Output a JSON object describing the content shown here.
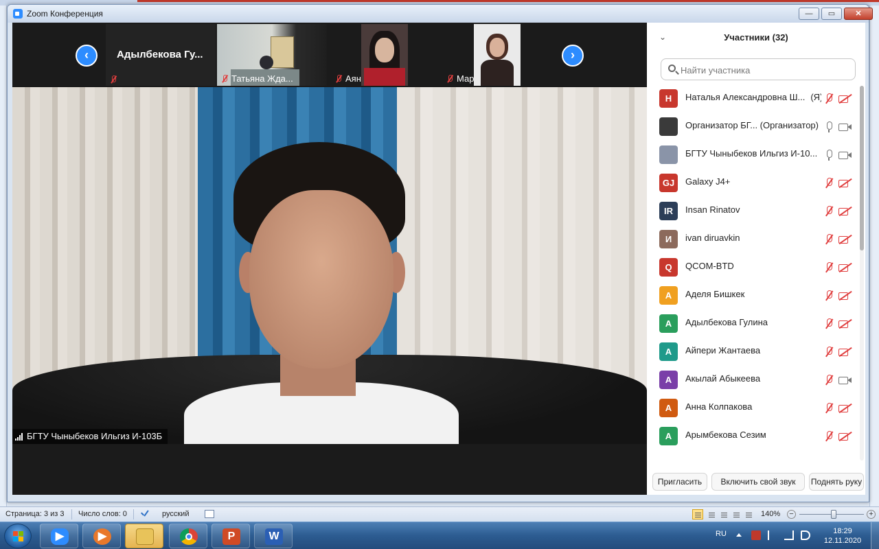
{
  "window": {
    "title": "Zoom Конференция",
    "minimize_label": "—",
    "maximize_label": "▭",
    "close_label": "✕"
  },
  "filmstrip": {
    "prev_label": "‹",
    "next_label": "›",
    "tiles": [
      {
        "name": "Адылбекова Гу...",
        "muted": true,
        "video": false
      },
      {
        "name": "Татьяна Жда...",
        "muted": true,
        "video": true
      },
      {
        "name": "Аяна",
        "muted": true,
        "video": true
      },
      {
        "name": "Марина Ому...",
        "muted": true,
        "video": true
      }
    ]
  },
  "main_video": {
    "speaker_name": "БГТУ Чыныбеков Ильгиз  И-103Б",
    "signal_icon": "signal-bars-icon"
  },
  "participants_panel": {
    "title": "Участники (32)",
    "collapse_icon": "chevron-down-icon",
    "search_placeholder": "Найти участника",
    "participants": [
      {
        "initials": "Н",
        "color": "#c8372d",
        "name": "Наталья Александровна Ш...",
        "tag": "(Я)",
        "mic": "off",
        "cam": "off"
      },
      {
        "initials": "",
        "color": "#3a3a3a",
        "name": "Организатор БГ... (Организатор)",
        "tag": "",
        "mic": "on",
        "cam": "on"
      },
      {
        "initials": "",
        "color": "#8a94a8",
        "name": "БГТУ Чыныбеков Ильгиз  И-10...",
        "tag": "",
        "mic": "on",
        "cam": "on"
      },
      {
        "initials": "GJ",
        "color": "#c8372d",
        "name": "Galaxy J4+",
        "tag": "",
        "mic": "off",
        "cam": "off"
      },
      {
        "initials": "IR",
        "color": "#2c3e58",
        "name": "Insan Rinatov",
        "tag": "",
        "mic": "off",
        "cam": "off"
      },
      {
        "initials": "И",
        "color": "#8c6a5c",
        "name": "ivan diruavkin",
        "tag": "",
        "mic": "off",
        "cam": "off"
      },
      {
        "initials": "Q",
        "color": "#c8372d",
        "name": "QCOM-BTD",
        "tag": "",
        "mic": "off",
        "cam": "off"
      },
      {
        "initials": "А",
        "color": "#f0a020",
        "name": "Аделя Бишкек",
        "tag": "",
        "mic": "off",
        "cam": "off"
      },
      {
        "initials": "А",
        "color": "#2a9e5c",
        "name": "Адылбекова Гулина",
        "tag": "",
        "mic": "off",
        "cam": "off"
      },
      {
        "initials": "А",
        "color": "#1f9a8a",
        "name": "Айпери Жантаева",
        "tag": "",
        "mic": "off",
        "cam": "off"
      },
      {
        "initials": "А",
        "color": "#7a3fa8",
        "name": "Акылай Абыкеева",
        "tag": "",
        "mic": "off",
        "cam": "on"
      },
      {
        "initials": "А",
        "color": "#d05a10",
        "name": "Анна Колпакова",
        "tag": "",
        "mic": "off",
        "cam": "off"
      },
      {
        "initials": "А",
        "color": "#2a9e5c",
        "name": "Арымбекова Сезим",
        "tag": "",
        "mic": "off",
        "cam": "off"
      }
    ],
    "buttons": {
      "invite": "Пригласить",
      "unmute": "Включить свой звук",
      "raise_hand": "Поднять руку"
    }
  },
  "word_statusbar": {
    "page": "Страница: 3 из 3",
    "words": "Число слов: 0",
    "language": "русский",
    "zoom": "140%",
    "zoom_minus": "−",
    "zoom_plus": "+"
  },
  "taskbar": {
    "apps": [
      {
        "name": "zoom",
        "icon": "zoom-app-icon",
        "active": false
      },
      {
        "name": "video-player",
        "icon": "video-player-icon",
        "active": false
      },
      {
        "name": "explorer",
        "icon": "folder-icon",
        "active": true
      },
      {
        "name": "chrome",
        "icon": "chrome-icon",
        "active": false
      },
      {
        "name": "powerpoint",
        "icon": "powerpoint-icon",
        "active": false
      },
      {
        "name": "word",
        "icon": "word-icon",
        "active": false
      }
    ],
    "tray_language": "RU",
    "clock_time": "18:29",
    "clock_date": "12.11.2020"
  }
}
